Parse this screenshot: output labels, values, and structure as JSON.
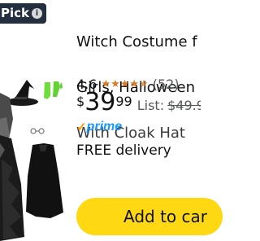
{
  "badge": {
    "label": "Pick",
    "icon": "info-icon",
    "icon_glyph": "i"
  },
  "product": {
    "image_icon": "witch-costume-product-image",
    "title_lines": [
      "Witch Costume f",
      "Girls, Halloween",
      "With Cloak Hat"
    ],
    "rating": "4.6",
    "star_icon": "star-icon",
    "review_count": "(52)",
    "price": {
      "symbol": "$",
      "whole": "39",
      "cents": "99"
    },
    "list_label": "List:",
    "list_price": "$49.9",
    "prime": {
      "check": "✓",
      "label": "prime"
    },
    "delivery": "FREE delivery",
    "add_to_cart": "Add to car"
  },
  "colors": {
    "badge_bg": "#232f3e",
    "star": "#de7921",
    "prime_blue": "#1a98ff",
    "prime_check": "#ff9900",
    "cart_button": "#ffd814"
  }
}
